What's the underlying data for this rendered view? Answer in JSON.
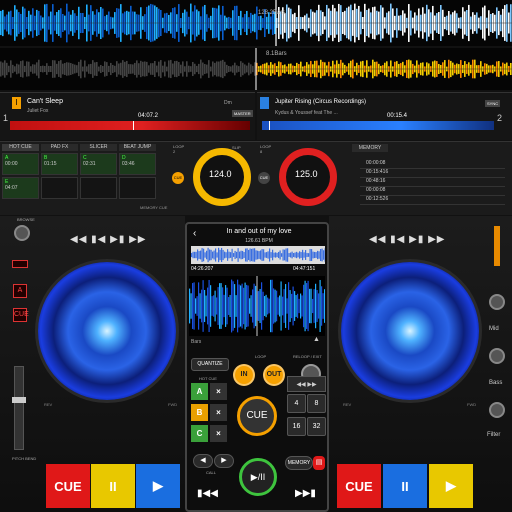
{
  "waveforms": {
    "bars_a": "128.2Bars",
    "bars_b": "8.1Bars"
  },
  "deck_a": {
    "number": "1",
    "title": "Can't Sleep",
    "artist": "Juliet Fox",
    "time": "04:07.2",
    "key": "Dm",
    "bpm": "124.0",
    "deck_label": "1",
    "mode": "MASTER",
    "pitch_label": "SLIP",
    "tabs": [
      "HOT CUE",
      "PAD FX",
      "SLICER",
      "BEAT JUMP"
    ],
    "pads": [
      {
        "letter": "A",
        "time": "00:00"
      },
      {
        "letter": "B",
        "time": "01:15"
      },
      {
        "letter": "C",
        "time": "02:31"
      },
      {
        "letter": "D",
        "time": "03:46"
      },
      {
        "letter": "E",
        "time": "04:07"
      }
    ],
    "memory_cue": "MEMORY CUE"
  },
  "deck_b": {
    "number": "2",
    "title": "Jupiter Rising (Circus Recordings)",
    "artist": "Kydus & Youssef feat The ...",
    "time": "00:15.4",
    "bpm": "125.0",
    "deck_label": "2",
    "mode": "SYNC",
    "memory": "MEMORY",
    "memory_items": [
      "00:00:08",
      "00:15:416",
      "00:48:16",
      "00:00:08",
      "00:12:526"
    ]
  },
  "left_panel": {
    "browse": "BROWSE",
    "btn_a": "A",
    "btn_cue": "CUE",
    "pitch_label": "PITCH BEND",
    "pitch_bend": "PITCH BEND"
  },
  "right_panel": {
    "mid": "Mid",
    "bass": "Bass",
    "filter": "Filter"
  },
  "transport_left": {
    "cue": "CUE",
    "play": "II",
    "next": "▶"
  },
  "transport_right": {
    "cue": "CUE",
    "play": "II",
    "next": "▶"
  },
  "transport_strip": "◀◀ ▮◀ ▶▮ ▶▶",
  "phone": {
    "song_title": "In and out of my love",
    "bpm": "126.61 BPM",
    "time_elapsed": "04:26:207",
    "time_remaining": "04:47:151",
    "bars_label": "Bars",
    "quantize": "QUANTIZE",
    "loop_label": "LOOP",
    "reloop_label": "RELOOP / EXIT",
    "loop_in": "IN",
    "loop_out": "OUT",
    "hot_cue_label": "HOT CUE",
    "hot_cues": [
      "A",
      "B",
      "C"
    ],
    "cue": "CUE",
    "beat_nums": [
      "4",
      "8",
      "16",
      "32"
    ],
    "call": "CALL",
    "memory": "MEMORY",
    "play_pause": "▶/II"
  },
  "colors": {
    "deck_a_accent": "#f5b800",
    "deck_b_accent": "#e02020",
    "cue_red": "#e01818",
    "play_yellow": "#e8c800",
    "play_blue": "#1a6ee0"
  }
}
